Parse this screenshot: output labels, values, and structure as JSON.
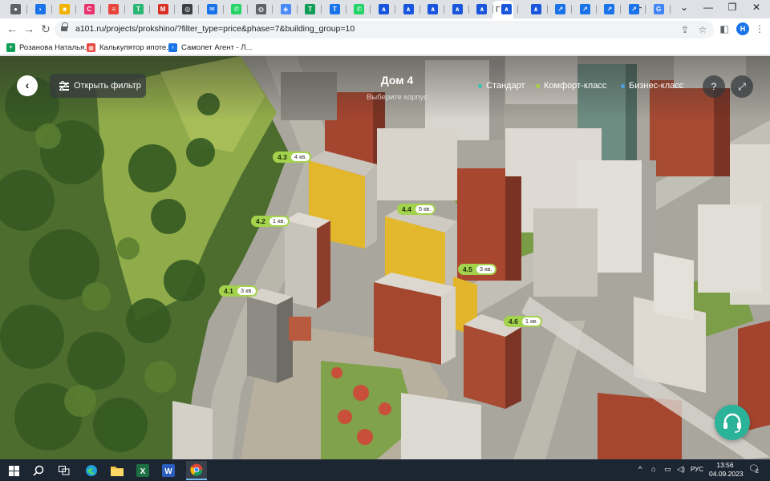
{
  "browser": {
    "active_tab_title": "Г",
    "tabs": [
      {
        "icon": "chrome-icon",
        "color": "#5f6368",
        "glyph": "●"
      },
      {
        "icon": "forward-arrow-icon",
        "color": "#1a73e8",
        "glyph": "›"
      },
      {
        "icon": "yellow-app-icon",
        "color": "#f2b300",
        "glyph": "■"
      },
      {
        "icon": "c-logo-icon",
        "color": "#e8336d",
        "glyph": "C"
      },
      {
        "icon": "document-icon",
        "color": "#e8453c",
        "glyph": "≡"
      },
      {
        "icon": "green-t-icon",
        "color": "#2ab673",
        "glyph": "T"
      },
      {
        "icon": "gmail-icon",
        "color": "#d93025",
        "glyph": "M"
      },
      {
        "icon": "camera-icon",
        "color": "#3c4043",
        "glyph": "◎"
      },
      {
        "icon": "mail-icon",
        "color": "#1a73e8",
        "glyph": "✉"
      },
      {
        "icon": "whatsapp-icon",
        "color": "#25d366",
        "glyph": "✆"
      },
      {
        "icon": "globe-icon",
        "color": "#5f6368",
        "glyph": "◍"
      },
      {
        "icon": "blue-square-icon",
        "color": "#4a8af4",
        "glyph": "◈"
      },
      {
        "icon": "sheets-icon",
        "color": "#0f9d58",
        "glyph": "T"
      },
      {
        "icon": "blue-t-icon",
        "color": "#1a73e8",
        "glyph": "T"
      },
      {
        "icon": "whatsapp-icon",
        "color": "#25d366",
        "glyph": "✆"
      },
      {
        "icon": "a101-icon",
        "color": "#1a56db",
        "glyph": "∧"
      },
      {
        "icon": "a101-icon",
        "color": "#1a56db",
        "glyph": "∧"
      },
      {
        "icon": "a101-icon",
        "color": "#1a56db",
        "glyph": "∧"
      },
      {
        "icon": "a101-icon",
        "color": "#1a56db",
        "glyph": "∧"
      },
      {
        "icon": "a101-icon",
        "color": "#1a56db",
        "glyph": "∧"
      },
      {
        "icon": "a101-icon",
        "color": "#1a56db",
        "glyph": "∧"
      },
      {
        "icon": "a101-icon",
        "color": "#1a56db",
        "glyph": "∧"
      },
      {
        "icon": "samolet-icon",
        "color": "#1a73e8",
        "glyph": "↗"
      },
      {
        "icon": "samolet-icon",
        "color": "#1a73e8",
        "glyph": "↗"
      },
      {
        "icon": "samolet-icon",
        "color": "#1a73e8",
        "glyph": "↗"
      },
      {
        "icon": "samolet-icon",
        "color": "#1a73e8",
        "glyph": "↗"
      },
      {
        "icon": "google-icon",
        "color": "#4285f4",
        "glyph": "G"
      }
    ],
    "tab_close_glyph": "✕",
    "new_tab_glyph": "+",
    "window_controls": {
      "chevron": "⌄",
      "minimize": "—",
      "restore": "❐",
      "close": "✕"
    },
    "url": "a101.ru/projects/prokshino/?filter_type=price&phase=7&building_group=10",
    "nav": {
      "back": "←",
      "forward": "→",
      "reload": "↻"
    },
    "profile_initial": "Н",
    "bookmarks": [
      {
        "label": "Розанова Наталья...",
        "icon": "sheets-icon",
        "color": "#0f9d58",
        "glyph": "+"
      },
      {
        "label": "Калькулятор ипоте...",
        "icon": "calculator-icon",
        "color": "#e8453c",
        "glyph": "▦"
      },
      {
        "label": "Самолет Агент - Л...",
        "icon": "samolet-icon",
        "color": "#1a73e8",
        "glyph": "›"
      }
    ]
  },
  "page": {
    "filter_button": "Открыть фильтр",
    "house_title": "Дом 4",
    "house_subtitle": "Выберите корпус",
    "legend": [
      {
        "label": "Стандарт",
        "color": "#37c2b0"
      },
      {
        "label": "Комфорт-класс",
        "color": "#a3d24c"
      },
      {
        "label": "Бизнес-класс",
        "color": "#4aa3df"
      }
    ],
    "help_glyph": "?",
    "fullscreen_glyph": "⤢",
    "buildings": [
      {
        "id": "4.3",
        "count": "4 кв."
      },
      {
        "id": "4.2",
        "count": "1 кв."
      },
      {
        "id": "4.1",
        "count": "3 кв."
      },
      {
        "id": "4.4",
        "count": "5 кв."
      },
      {
        "id": "4.5",
        "count": "3 кв."
      },
      {
        "id": "4.6",
        "count": "1 кв."
      }
    ]
  },
  "taskbar": {
    "apps": [
      "start-icon",
      "search-icon",
      "task-view-icon",
      "edge-icon",
      "file-explorer-icon",
      "excel-icon",
      "word-icon",
      "chrome-icon"
    ],
    "tray": {
      "chevron": "^",
      "language": "РУС",
      "notifications": "2"
    },
    "time": "13:56",
    "date": "04.09.2023"
  }
}
